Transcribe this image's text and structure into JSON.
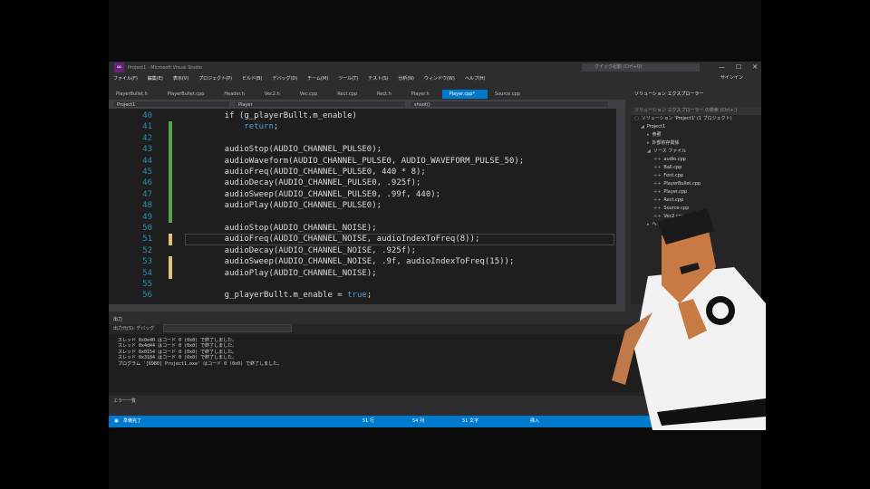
{
  "window": {
    "title": "Project1 - Microsoft Visual Studio",
    "quick_launch_placeholder": "クイック起動 (Ctrl+Q)",
    "signin": "サインイン"
  },
  "menu": [
    "ファイル(F)",
    "編集(E)",
    "表示(V)",
    "プロジェクト(P)",
    "ビルド(B)",
    "デバッグ(D)",
    "チーム(M)",
    "ツール(T)",
    "テスト(S)",
    "分析(N)",
    "ウィンドウ(W)",
    "ヘルプ(H)"
  ],
  "tabs": [
    {
      "label": "PlayerBullet.h",
      "active": false
    },
    {
      "label": "PlayerBullet.cpp",
      "active": false
    },
    {
      "label": "Header.h",
      "active": false
    },
    {
      "label": "Vec2.h",
      "active": false
    },
    {
      "label": "Vec.cpp",
      "active": false
    },
    {
      "label": "Rect.cpp",
      "active": false
    },
    {
      "label": "Rect.h",
      "active": false
    },
    {
      "label": "Player.h",
      "active": false
    },
    {
      "label": "Player.cpp*",
      "active": true
    },
    {
      "label": "Source.cpp",
      "active": false
    }
  ],
  "navbar": {
    "project": "Project1",
    "scope": "Player",
    "member": "shoot()"
  },
  "code_lines": [
    {
      "n": "40",
      "text": "    if (g_playerBullt.m_enable)",
      "change": "",
      "current": false
    },
    {
      "n": "41",
      "text": "        return;",
      "change": "g",
      "current": false
    },
    {
      "n": "42",
      "text": "",
      "change": "g",
      "current": false
    },
    {
      "n": "43",
      "text": "    audioStop(AUDIO_CHANNEL_PULSE0);",
      "change": "g",
      "current": false
    },
    {
      "n": "44",
      "text": "    audioWaveform(AUDIO_CHANNEL_PULSE0, AUDIO_WAVEFORM_PULSE_50);",
      "change": "g",
      "current": false
    },
    {
      "n": "45",
      "text": "    audioFreq(AUDIO_CHANNEL_PULSE0, 440 * 8);",
      "change": "g",
      "current": false
    },
    {
      "n": "46",
      "text": "    audioDecay(AUDIO_CHANNEL_PULSE0, .925f);",
      "change": "g",
      "current": false
    },
    {
      "n": "47",
      "text": "    audioSweep(AUDIO_CHANNEL_PULSE0, .99f, 440);",
      "change": "g",
      "current": false
    },
    {
      "n": "48",
      "text": "    audioPlay(AUDIO_CHANNEL_PULSE0);",
      "change": "g",
      "current": false
    },
    {
      "n": "49",
      "text": "",
      "change": "g",
      "current": false
    },
    {
      "n": "50",
      "text": "    audioStop(AUDIO_CHANNEL_NOISE);",
      "change": "",
      "current": false
    },
    {
      "n": "51",
      "text": "    audioFreq(AUDIO_CHANNEL_NOISE, audioIndexToFreq(8));",
      "change": "y",
      "current": true
    },
    {
      "n": "52",
      "text": "    audioDecay(AUDIO_CHANNEL_NOISE, .925f);",
      "change": "",
      "current": false
    },
    {
      "n": "53",
      "text": "    audioSweep(AUDIO_CHANNEL_NOISE, .9f, audioIndexToFreq(15));",
      "change": "y",
      "current": false
    },
    {
      "n": "54",
      "text": "    audioPlay(AUDIO_CHANNEL_NOISE);",
      "change": "y",
      "current": false
    },
    {
      "n": "55",
      "text": "",
      "change": "",
      "current": false
    },
    {
      "n": "56",
      "text": "    g_playerBullt.m_enable = true;",
      "change": "",
      "current": false
    }
  ],
  "solution_explorer": {
    "title": "ソリューション エクスプローラー",
    "search": "ソリューション エクスプローラー の検索 (Ctrl+;)",
    "items": [
      {
        "indent": 0,
        "icon": "▢",
        "label": "ソリューション 'Project1' (1 プロジェクト)"
      },
      {
        "indent": 1,
        "icon": "◢",
        "label": "Project1"
      },
      {
        "indent": 2,
        "icon": "▸",
        "label": "参照"
      },
      {
        "indent": 2,
        "icon": "▸",
        "label": "外部依存関係"
      },
      {
        "indent": 2,
        "icon": "◢",
        "label": "ソース ファイル"
      },
      {
        "indent": 3,
        "icon": "++",
        "label": "audio.cpp"
      },
      {
        "indent": 3,
        "icon": "++",
        "label": "Ball.cpp"
      },
      {
        "indent": 3,
        "icon": "++",
        "label": "Font.cpp"
      },
      {
        "indent": 3,
        "icon": "++",
        "label": "PlayerBullet.cpp"
      },
      {
        "indent": 3,
        "icon": "++",
        "label": "Player.cpp"
      },
      {
        "indent": 3,
        "icon": "++",
        "label": "Rect.cpp"
      },
      {
        "indent": 3,
        "icon": "++",
        "label": "Source.cpp"
      },
      {
        "indent": 3,
        "icon": "++",
        "label": "Vec2.cpp"
      },
      {
        "indent": 2,
        "icon": "▸",
        "label": "ヘッダー ファイル"
      }
    ]
  },
  "output": {
    "title": "出力",
    "source_label": "出力元(S):",
    "source_value": "デバッグ",
    "lines": [
      "スレッド 0x0e40 はコード 0 (0x0) で終了しました。",
      "スレッド 0x4d44 はコード 0 (0x0) で終了しました。",
      "スレッド 0x0154 はコード 0 (0x0) で終了しました。",
      "スレッド 0x3184 はコード 0 (0x0) で終了しました。",
      "プログラム '[6980] Project1.exe' はコード 0 (0x0) で終了しました。"
    ],
    "error_tab": "エラー一覧"
  },
  "status": {
    "ready": "準備完了",
    "line": "51 行",
    "col": "54 列",
    "char": "51 文字",
    "mode": "挿入"
  }
}
